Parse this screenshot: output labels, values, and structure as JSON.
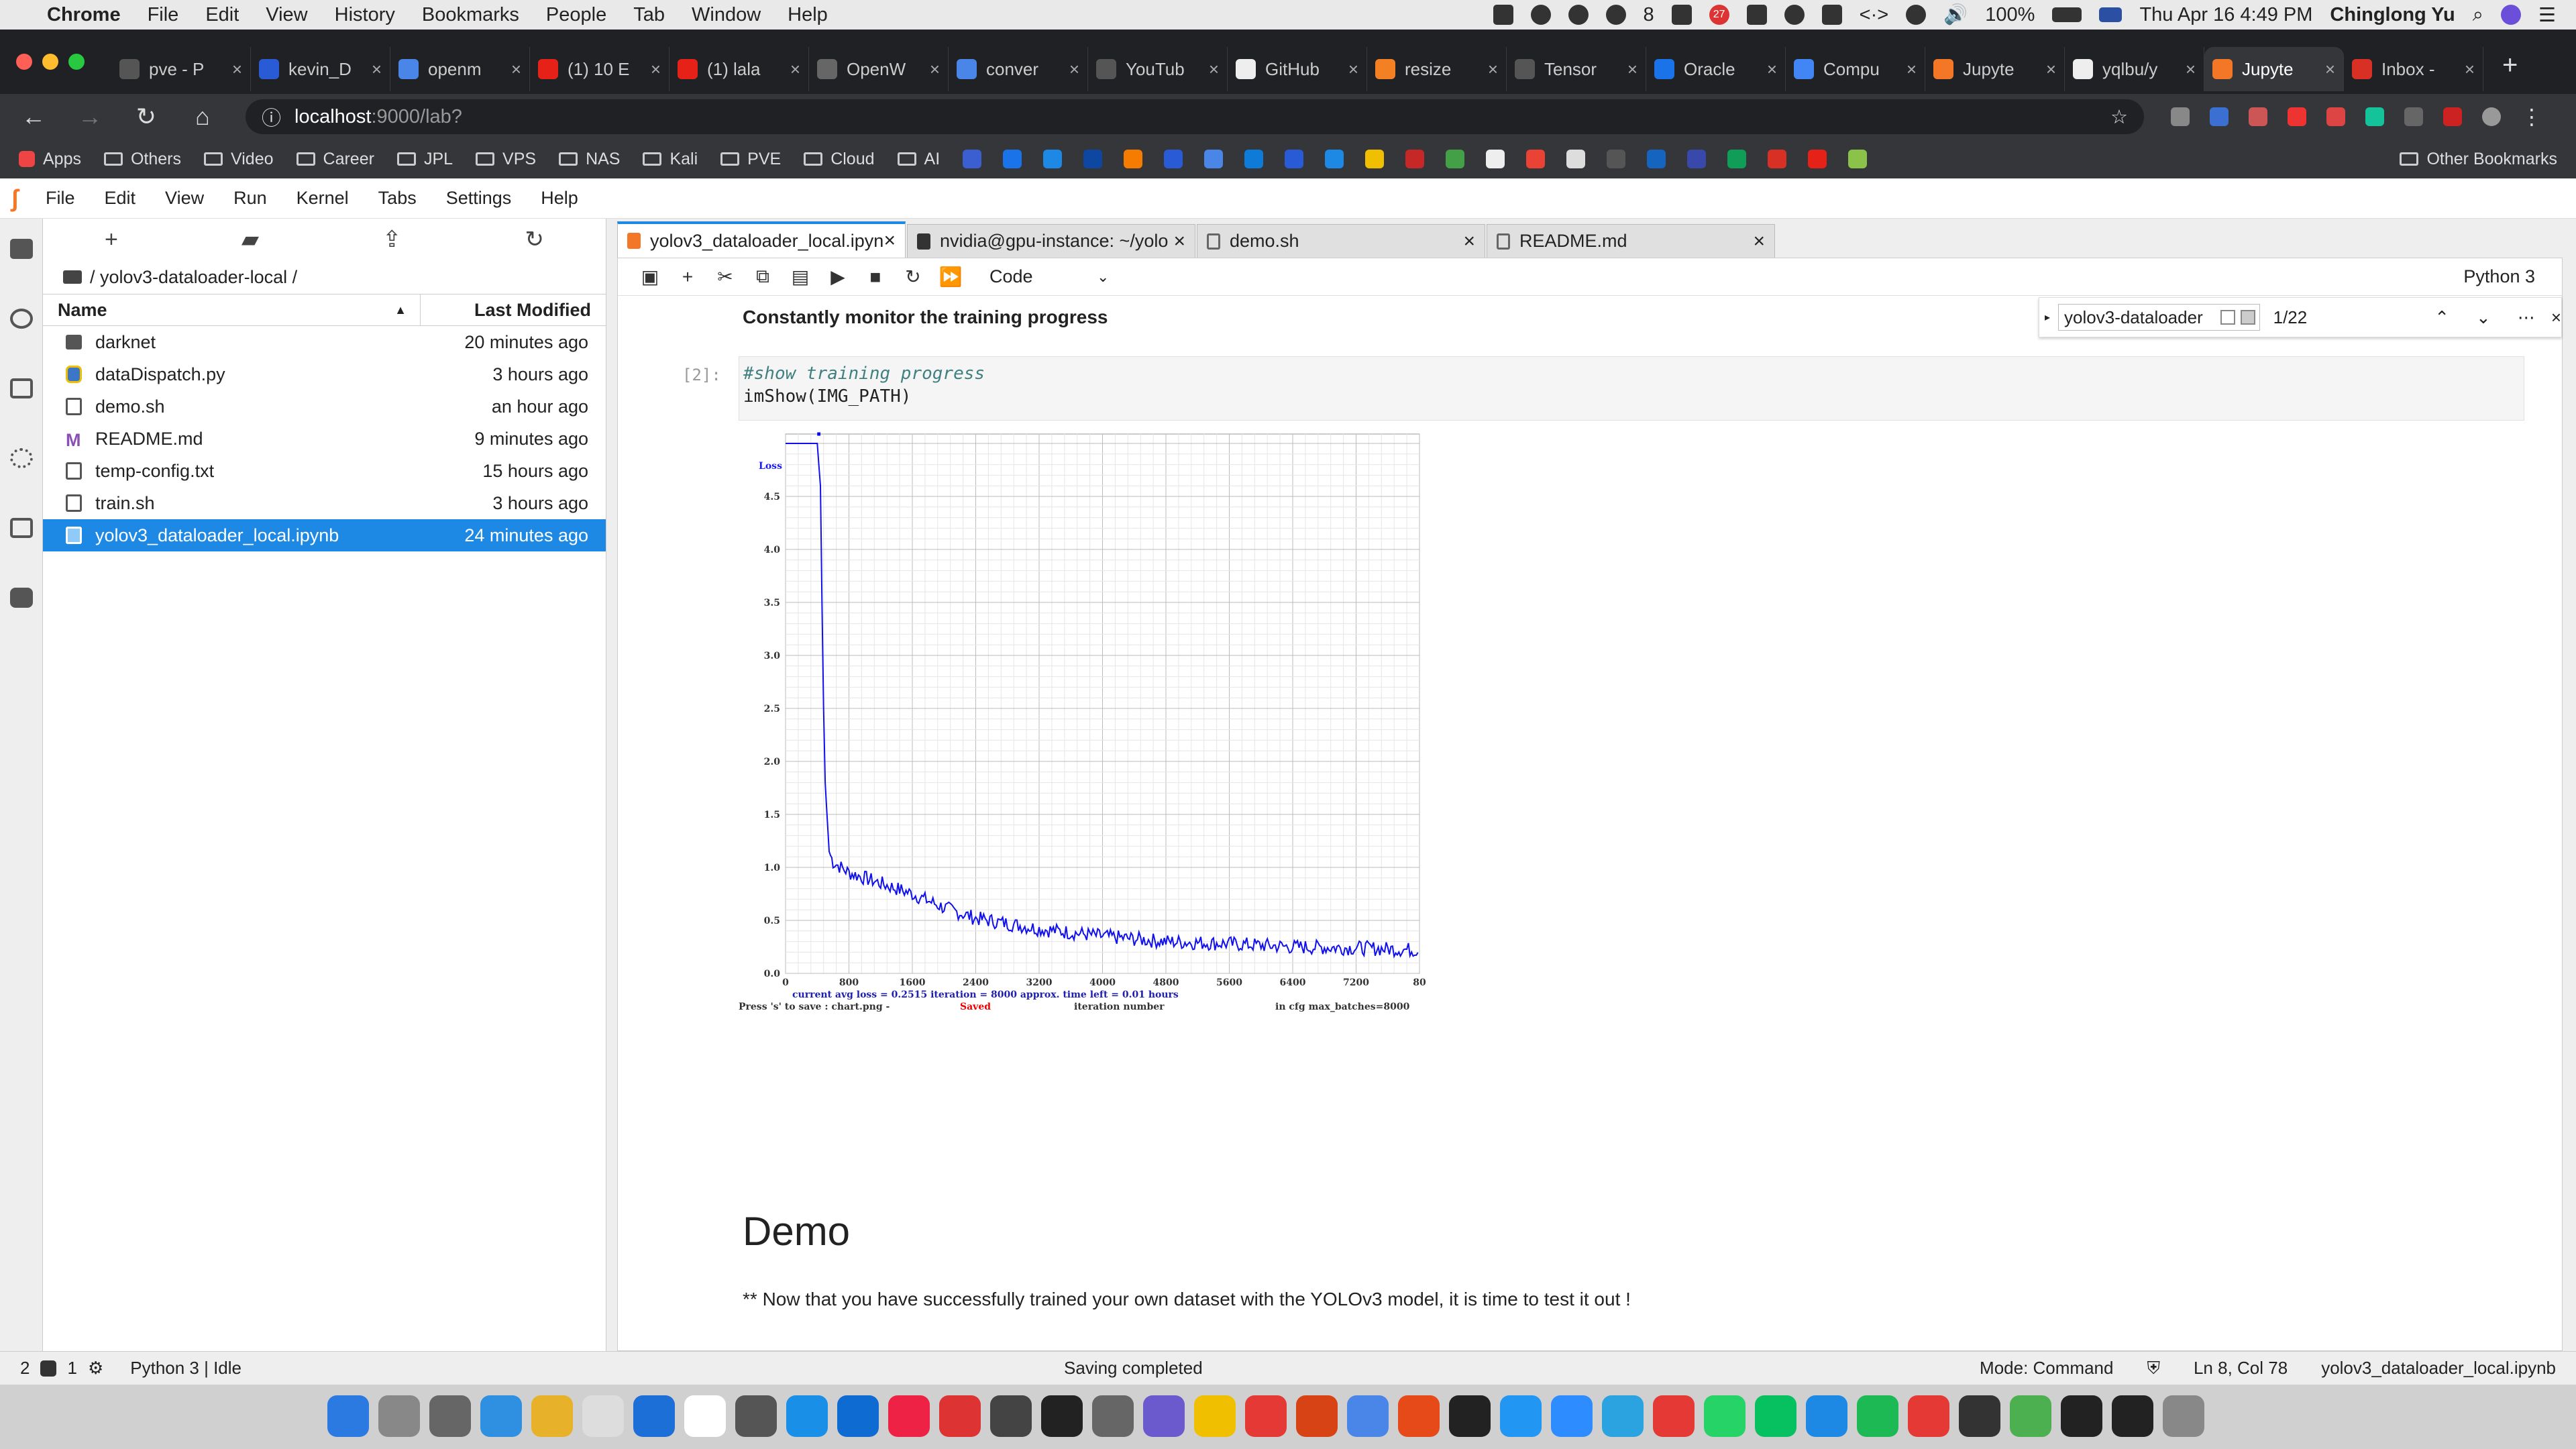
{
  "menubar": {
    "app": "Chrome",
    "menus": [
      "File",
      "Edit",
      "View",
      "History",
      "Bookmarks",
      "People",
      "Tab",
      "Window",
      "Help"
    ],
    "notification_count": "8",
    "badge_count": "27",
    "battery": "100%",
    "datetime": "Thu Apr 16  4:49 PM",
    "user": "Chinglong Yu"
  },
  "chrome": {
    "tabs": [
      {
        "title": "pve - P",
        "color": "#555"
      },
      {
        "title": "kevin_D",
        "color": "#2a5bd7"
      },
      {
        "title": "openm",
        "color": "#4a86e8"
      },
      {
        "title": "(1) 10 E",
        "color": "#e62117"
      },
      {
        "title": "(1) lala",
        "color": "#e62117"
      },
      {
        "title": "OpenW",
        "color": "#666"
      },
      {
        "title": "conver",
        "color": "#4a86e8"
      },
      {
        "title": "YouTub",
        "color": "#555"
      },
      {
        "title": "GitHub",
        "color": "#eee"
      },
      {
        "title": "resize",
        "color": "#f48024"
      },
      {
        "title": "Tensor",
        "color": "#555"
      },
      {
        "title": "Oracle",
        "color": "#1a73e8"
      },
      {
        "title": "Compu",
        "color": "#4285f4"
      },
      {
        "title": "Jupyte",
        "color": "#f37726"
      },
      {
        "title": "yqlbu/y",
        "color": "#eee"
      },
      {
        "title": "Jupyte",
        "color": "#f37726",
        "active": true
      },
      {
        "title": "Inbox -",
        "color": "#d93025"
      }
    ],
    "url_host": "localhost",
    "url_path": ":9000/lab?",
    "bookmarks": [
      "Apps",
      "Others",
      "Video",
      "Career",
      "JPL",
      "VPS",
      "NAS",
      "Kali",
      "PVE",
      "Cloud",
      "AI"
    ],
    "other_bookmarks": "Other Bookmarks"
  },
  "jupyter": {
    "menu": [
      "File",
      "Edit",
      "View",
      "Run",
      "Kernel",
      "Tabs",
      "Settings",
      "Help"
    ],
    "breadcrumb": "/ yolov3-dataloader-local /",
    "col_name": "Name",
    "col_modified": "Last Modified",
    "files": [
      {
        "name": "darknet",
        "modified": "20 minutes ago",
        "type": "dir"
      },
      {
        "name": "dataDispatch.py",
        "modified": "3 hours ago",
        "type": "py"
      },
      {
        "name": "demo.sh",
        "modified": "an hour ago",
        "type": "file"
      },
      {
        "name": "README.md",
        "modified": "9 minutes ago",
        "type": "md"
      },
      {
        "name": "temp-config.txt",
        "modified": "15 hours ago",
        "type": "file"
      },
      {
        "name": "train.sh",
        "modified": "3 hours ago",
        "type": "file"
      },
      {
        "name": "yolov3_dataloader_local.ipynb",
        "modified": "24 minutes ago",
        "type": "nb",
        "selected": true
      }
    ],
    "doc_tabs": [
      "yolov3_dataloader_local.ipynb",
      "nvidia@gpu-instance: ~/yolo",
      "demo.sh",
      "README.md"
    ],
    "cell_type": "Code",
    "kernel": "Python 3",
    "find": {
      "query": "yolov3-dataloader",
      "count": "1/22"
    },
    "monitor_text": "Constantly monitor the training progress",
    "prompt": "[2]:",
    "code_comment": "#show training progress",
    "code_line": "imShow(IMG_PATH)",
    "demo_heading": "Demo",
    "demo_text": "** Now that you have successfully trained your own dataset with the YOLOv3 model, it is time to test it out !"
  },
  "chart_data": {
    "type": "line",
    "ylabel": "Loss",
    "xlabel": "iteration number",
    "xticks": [
      "0",
      "800",
      "1600",
      "2400",
      "3200",
      "4000",
      "4800",
      "5600",
      "6400",
      "7200",
      "80"
    ],
    "yticks": [
      "0.0",
      "0.5",
      "1.0",
      "1.5",
      "2.0",
      "2.5",
      "3.0",
      "3.5",
      "4.0",
      "4.5"
    ],
    "xlim": [
      0,
      8000
    ],
    "ylim": [
      0,
      5
    ],
    "series": [
      {
        "x": [
          0,
          400,
          440,
          460,
          480,
          500,
          550,
          600,
          800,
          1200,
          1600,
          2000,
          2400,
          3200,
          4000,
          4800,
          5600,
          6400,
          7200,
          8000
        ],
        "y": [
          5,
          5,
          4.6,
          3.5,
          2.5,
          1.8,
          1.15,
          1.05,
          0.95,
          0.85,
          0.75,
          0.62,
          0.52,
          0.42,
          0.35,
          0.3,
          0.28,
          0.25,
          0.24,
          0.22
        ]
      }
    ],
    "status_line": "current avg loss = 0.2515    iteration = 8000     approx. time left = 0.01 hours",
    "save_hint": "Press 's' to save : chart.png - ",
    "saved": "Saved",
    "batches": "in cfg max_batches=8000"
  },
  "status": {
    "left1": "2",
    "left2": "1",
    "kernel_state": "Python 3 | Idle",
    "center": "Saving completed",
    "mode": "Mode: Command",
    "position": "Ln 8, Col 78",
    "filename": "yolov3_dataloader_local.ipynb"
  },
  "dock": {
    "colors": [
      "#2a7ae2",
      "#888",
      "#666",
      "#2f8fe0",
      "#e8b12a",
      "#ddd",
      "#1d6fd8",
      "#fff",
      "#555",
      "#1a8fe8",
      "#0e6bd1",
      "#e24",
      "#d33",
      "#444",
      "#222",
      "#666",
      "#6a5acd",
      "#f0c000",
      "#e53935",
      "#d84315",
      "#4a86e8",
      "#e64a19",
      "#222",
      "#2196f3",
      "#2d8cff",
      "#2aa3e0",
      "#e53935",
      "#25d366",
      "#07c160",
      "#1e88e5",
      "#1db954",
      "#e53935",
      "#333",
      "#4caf50",
      "#222",
      "#222",
      "#888"
    ]
  }
}
